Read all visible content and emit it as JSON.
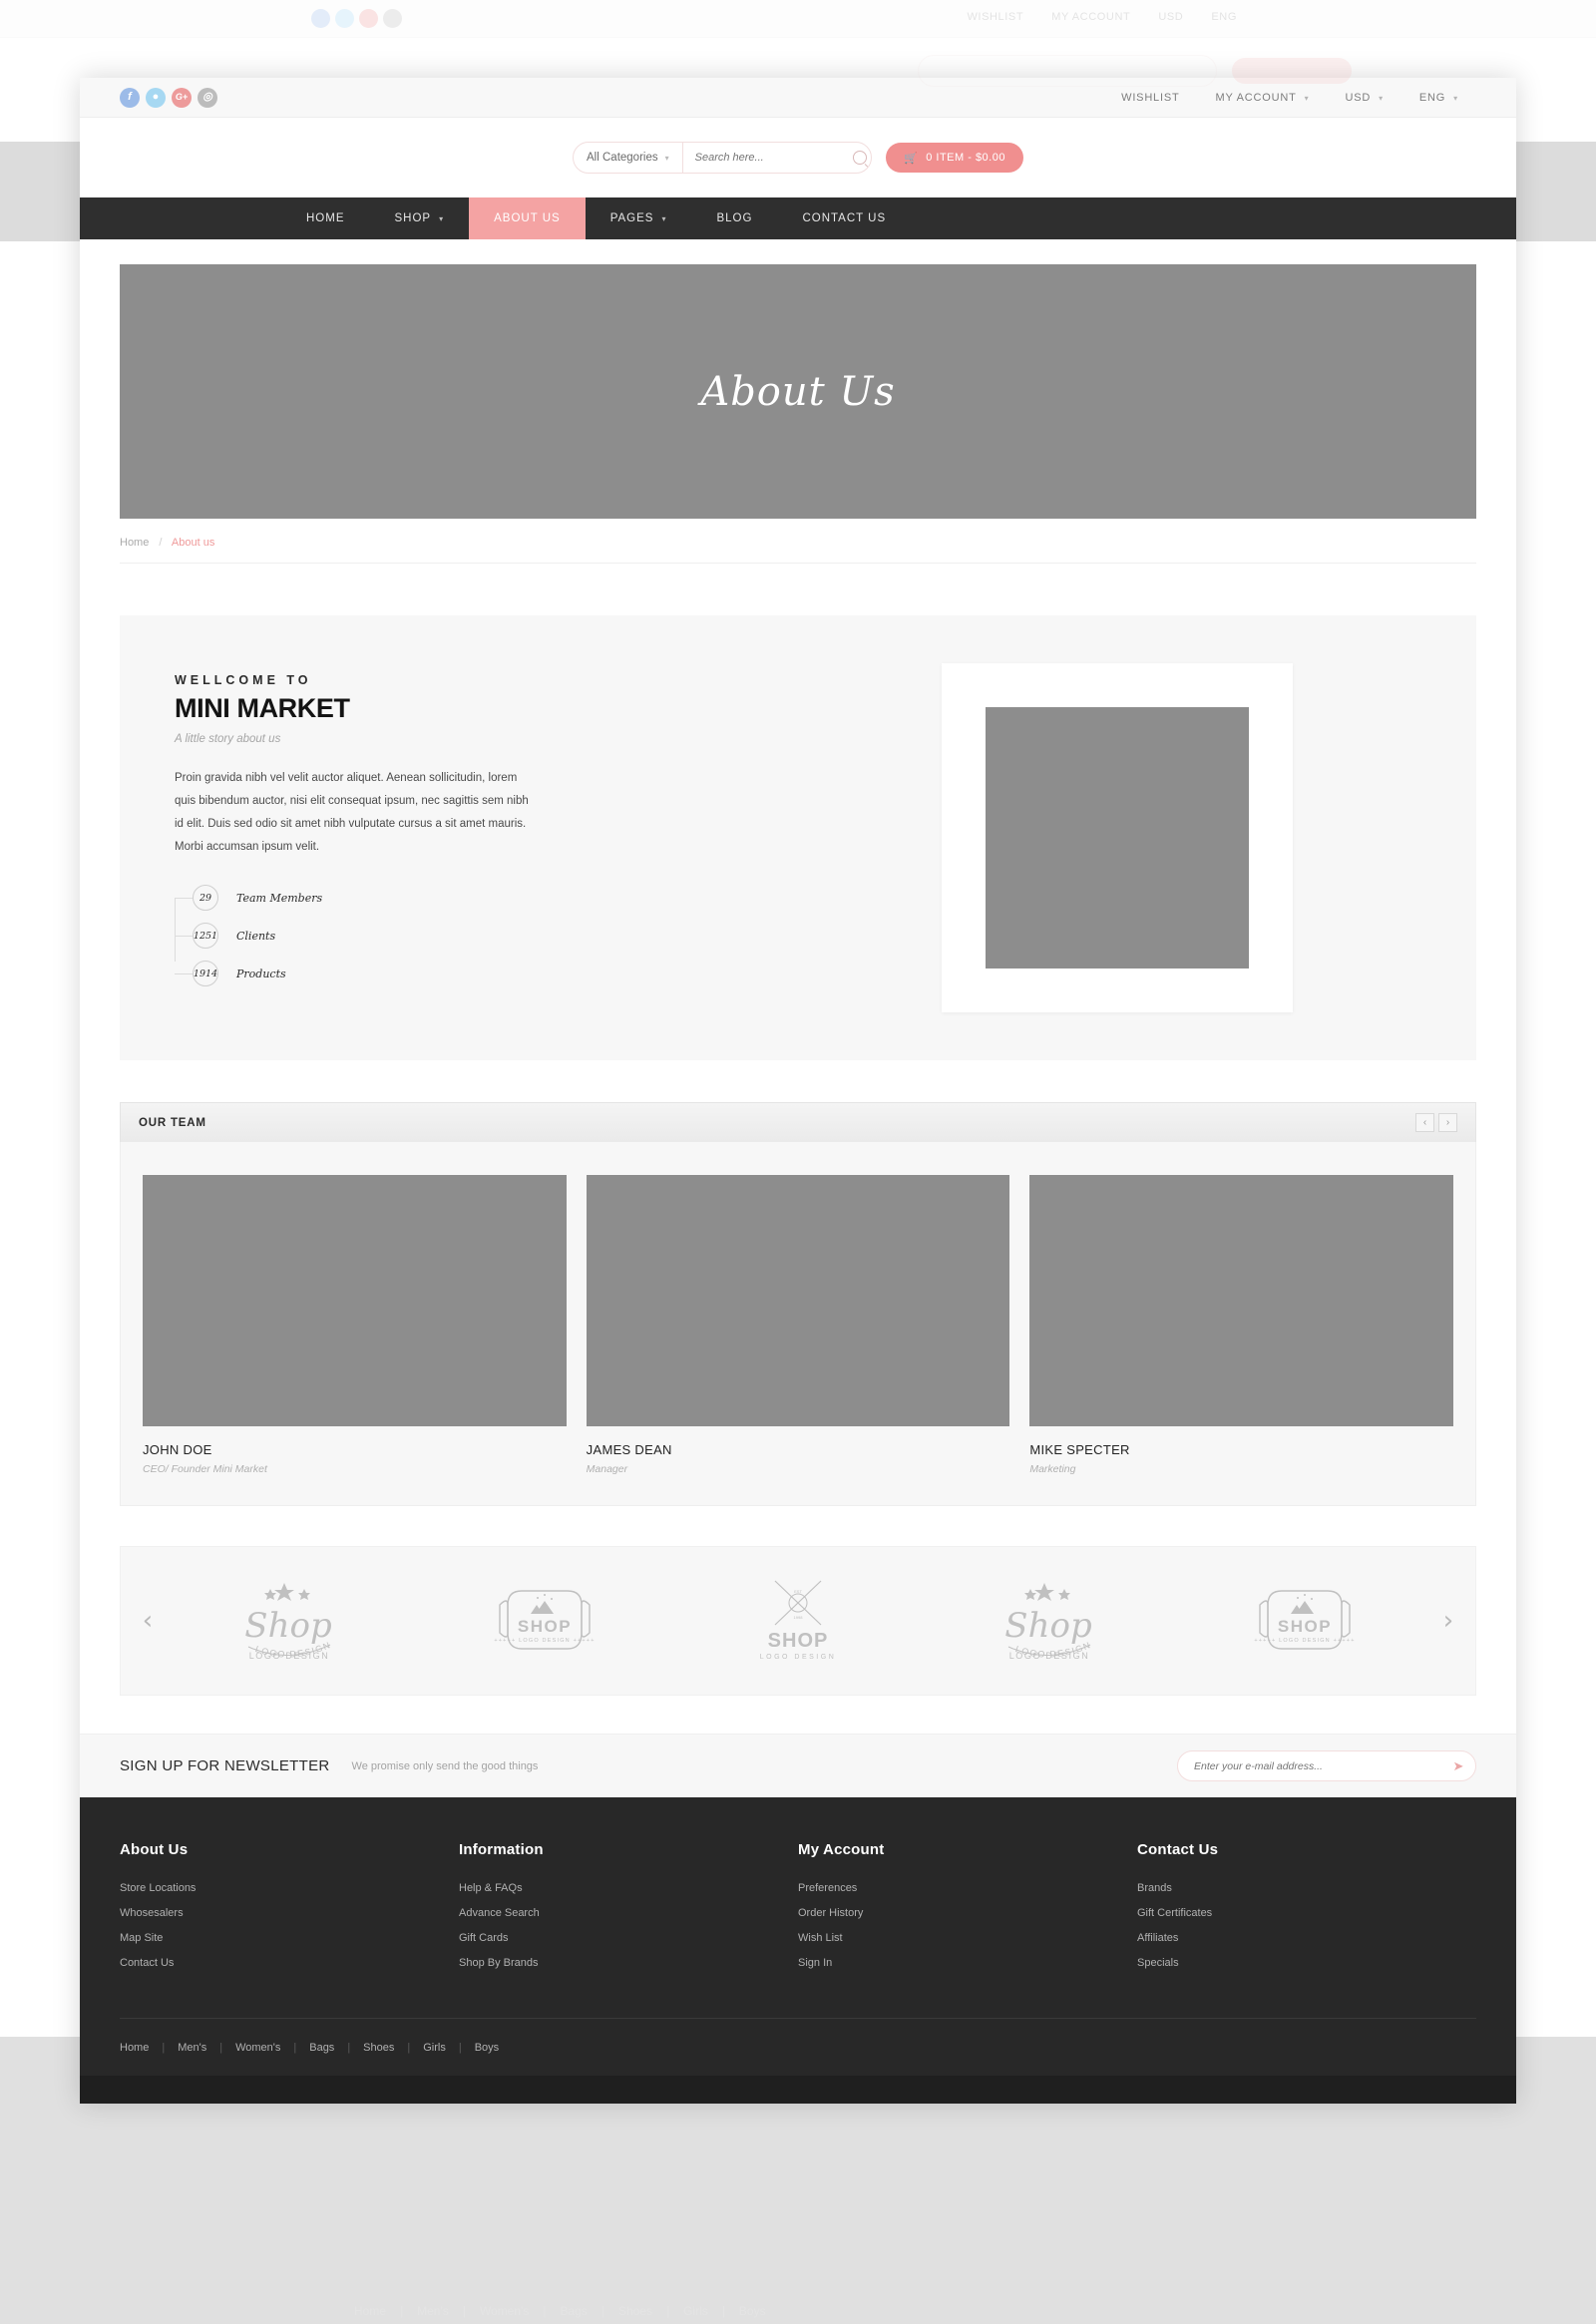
{
  "topbar": {
    "social": [
      {
        "name": "facebook",
        "glyph": "f",
        "color": "#9cbbe8"
      },
      {
        "name": "twitter",
        "glyph": "t",
        "color": "#a6d8f2"
      },
      {
        "name": "google-plus",
        "glyph": "G+",
        "color": "#ed9b9b"
      },
      {
        "name": "instagram",
        "glyph": "◎",
        "color": "#bcbcbc"
      }
    ],
    "wishlist": "WISHLIST",
    "my_account": "MY ACCOUNT",
    "currency": "USD",
    "language": "ENG"
  },
  "search": {
    "category_label": "All Categories",
    "placeholder": "Search here...",
    "value": "",
    "search_icon": "search-icon",
    "cart_label": "0 ITEM - $0.00",
    "cart_icon": "🛒"
  },
  "nav": {
    "items": [
      {
        "label": "HOME",
        "active": false,
        "caret": false
      },
      {
        "label": "SHOP",
        "active": false,
        "caret": true
      },
      {
        "label": "ABOUT US",
        "active": true,
        "caret": false
      },
      {
        "label": "PAGES",
        "active": false,
        "caret": true
      },
      {
        "label": "BLOG",
        "active": false,
        "caret": false
      },
      {
        "label": "CONTACT US",
        "active": false,
        "caret": false
      }
    ]
  },
  "hero": {
    "title": "About Us"
  },
  "breadcrumb": {
    "home": "Home",
    "separator": "/",
    "current": "About us"
  },
  "about": {
    "kicker": "WELLCOME TO",
    "title": "MINI MARKET",
    "subtitle": "A little story about us",
    "paragraph": "Proin gravida nibh vel velit auctor aliquet. Aenean sollicitudin, lorem quis bibendum auctor, nisi elit consequat ipsum, nec sagittis sem nibh id elit. Duis sed odio sit amet nibh vulputate cursus a sit amet mauris. Morbi accumsan ipsum velit.",
    "stats": [
      {
        "value": "29",
        "label": "Team Members"
      },
      {
        "value": "1251",
        "label": "Clients"
      },
      {
        "value": "1914",
        "label": "Products"
      }
    ]
  },
  "team": {
    "heading": "OUR TEAM",
    "prev_icon": "‹",
    "next_icon": "›",
    "members": [
      {
        "name": "JOHN DOE",
        "role": "CEO/ Founder Mini Market"
      },
      {
        "name": "JAMES DEAN",
        "role": "Manager"
      },
      {
        "name": "MIKE SPECTER",
        "role": "Marketing"
      }
    ]
  },
  "brands": {
    "prev_icon": "‹",
    "next_icon": "›",
    "logos": [
      {
        "style": "script",
        "title": "Shop",
        "sub": "LOGO DESIGN"
      },
      {
        "style": "badge",
        "title": "SHOP",
        "sub": "LOGO DESIGN"
      },
      {
        "style": "cross",
        "title": "SHOP",
        "sub": "LOGO DESIGN"
      },
      {
        "style": "script",
        "title": "Shop",
        "sub": "LOGO DESIGN"
      },
      {
        "style": "badge",
        "title": "SHOP",
        "sub": "LOGO DESIGN"
      }
    ]
  },
  "newsletter": {
    "title": "SIGN UP FOR NEWSLETTER",
    "subtitle": "We promise only send the good things",
    "placeholder": "Enter your e-mail address...",
    "value": "",
    "send_icon": "➤"
  },
  "footer": {
    "columns": [
      {
        "title": "About Us",
        "links": [
          "Store Locations",
          "Whosesalers",
          "Map Site",
          "Contact Us"
        ]
      },
      {
        "title": "Information",
        "links": [
          "Help & FAQs",
          "Advance Search",
          "Gift Cards",
          "Shop By Brands"
        ]
      },
      {
        "title": "My Account",
        "links": [
          "Preferences",
          "Order History",
          "Wish List",
          "Sign In"
        ]
      },
      {
        "title": "Contact Us",
        "links": [
          "Brands",
          "Gift Certificates",
          "Affiliates",
          "Specials"
        ]
      }
    ],
    "bottom_links": [
      "Home",
      "Men's",
      "Women's",
      "Bags",
      "Shoes",
      "Girls",
      "Boys"
    ],
    "bottom_separator": "|"
  },
  "colors": {
    "accent": "#f08f8f",
    "nav_bg": "#2f2f2f",
    "footer_bg": "#282828",
    "placeholder_gray": "#8d8d8d",
    "panel_bg": "#f7f7f7"
  }
}
